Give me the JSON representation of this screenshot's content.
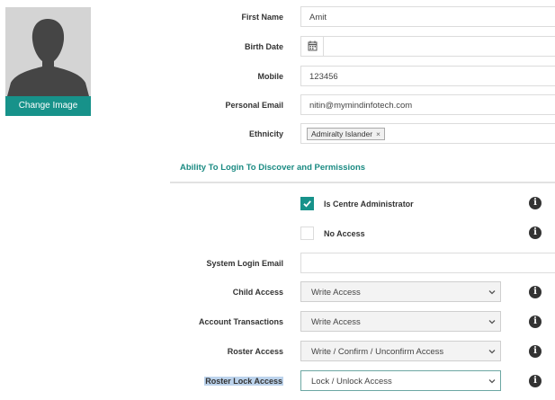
{
  "profile": {
    "change_image_label": "Change Image"
  },
  "personal": {
    "first_name_label": "First Name",
    "first_name_value": "Amit",
    "birth_date_label": "Birth Date",
    "birth_date_value": "",
    "mobile_label": "Mobile",
    "mobile_value": "123456",
    "email_label": "Personal Email",
    "email_value": "nitin@mymindinfotech.com",
    "ethnicity_label": "Ethnicity",
    "ethnicity_tag": "Admiralty Islander",
    "ethnicity_tag_remove": "×"
  },
  "permissions": {
    "section_title": "Ability To Login To Discover and Permissions",
    "centre_admin_label": "Is Centre Administrator",
    "centre_admin_checked": true,
    "no_access_label": "No Access",
    "no_access_checked": false,
    "login_email_label": "System Login Email",
    "login_email_value": "",
    "info_glyph": "i",
    "rows": [
      {
        "label": "Child Access",
        "value": "Write Access"
      },
      {
        "label": "Account Transactions",
        "value": "Write Access"
      },
      {
        "label": "Roster Access",
        "value": "Write / Confirm / Unconfirm Access"
      },
      {
        "label": "Roster Lock Access",
        "value": "Lock / Unlock Access"
      }
    ]
  },
  "colors": {
    "accent": "#17928a",
    "section_title": "#1a8a82",
    "highlight": "#bcd3ec"
  }
}
